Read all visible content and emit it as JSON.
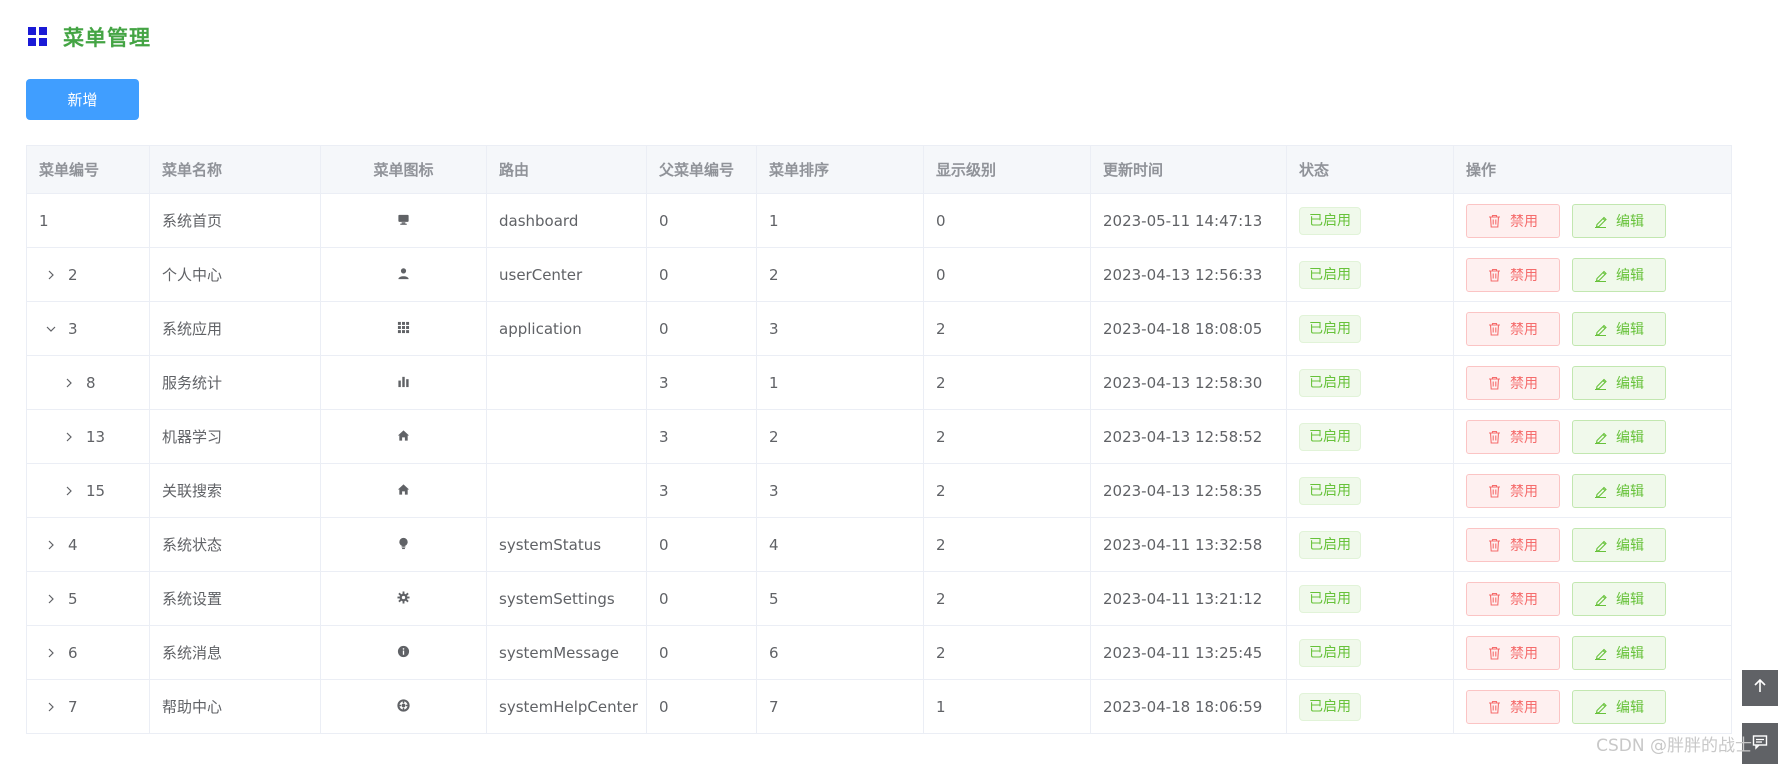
{
  "page": {
    "title": "菜单管理",
    "title_color": "#44a444",
    "icon": "grid-icon"
  },
  "toolbar": {
    "add_label": "新增",
    "add_color": "#409eff"
  },
  "table": {
    "headers": [
      "菜单编号",
      "菜单名称",
      "菜单图标",
      "路由",
      "父菜单编号",
      "菜单排序",
      "显示级别",
      "更新时间",
      "状态",
      "操作"
    ],
    "rows": [
      {
        "id": "1",
        "name": "系统首页",
        "icon": "monitor-icon",
        "route": "dashboard",
        "parent": "0",
        "order": "1",
        "level": "0",
        "updated": "2023-05-11 14:47:13",
        "status": "已启用",
        "indent": 0,
        "expander": "none"
      },
      {
        "id": "2",
        "name": "个人中心",
        "icon": "user-icon",
        "route": "userCenter",
        "parent": "0",
        "order": "2",
        "level": "0",
        "updated": "2023-04-13 12:56:33",
        "status": "已启用",
        "indent": 0,
        "expander": "collapsed"
      },
      {
        "id": "3",
        "name": "系统应用",
        "icon": "apps-icon",
        "route": "application",
        "parent": "0",
        "order": "3",
        "level": "2",
        "updated": "2023-04-18 18:08:05",
        "status": "已启用",
        "indent": 0,
        "expander": "expanded"
      },
      {
        "id": "8",
        "name": "服务统计",
        "icon": "bar-chart-icon",
        "route": "",
        "parent": "3",
        "order": "1",
        "level": "2",
        "updated": "2023-04-13 12:58:30",
        "status": "已启用",
        "indent": 1,
        "expander": "collapsed"
      },
      {
        "id": "13",
        "name": "机器学习",
        "icon": "home-icon",
        "route": "",
        "parent": "3",
        "order": "2",
        "level": "2",
        "updated": "2023-04-13 12:58:52",
        "status": "已启用",
        "indent": 1,
        "expander": "collapsed"
      },
      {
        "id": "15",
        "name": "关联搜索",
        "icon": "home-icon",
        "route": "",
        "parent": "3",
        "order": "3",
        "level": "2",
        "updated": "2023-04-13 12:58:35",
        "status": "已启用",
        "indent": 1,
        "expander": "collapsed"
      },
      {
        "id": "4",
        "name": "系统状态",
        "icon": "bulb-icon",
        "route": "systemStatus",
        "parent": "0",
        "order": "4",
        "level": "2",
        "updated": "2023-04-11 13:32:58",
        "status": "已启用",
        "indent": 0,
        "expander": "collapsed"
      },
      {
        "id": "5",
        "name": "系统设置",
        "icon": "gear-icon",
        "route": "systemSettings",
        "parent": "0",
        "order": "5",
        "level": "2",
        "updated": "2023-04-11 13:21:12",
        "status": "已启用",
        "indent": 0,
        "expander": "collapsed"
      },
      {
        "id": "6",
        "name": "系统消息",
        "icon": "info-icon",
        "route": "systemMessage",
        "parent": "0",
        "order": "6",
        "level": "2",
        "updated": "2023-04-11 13:25:45",
        "status": "已启用",
        "indent": 0,
        "expander": "collapsed"
      },
      {
        "id": "7",
        "name": "帮助中心",
        "icon": "help-icon",
        "route": "systemHelpCenter",
        "parent": "0",
        "order": "7",
        "level": "1",
        "updated": "2023-04-18 18:06:59",
        "status": "已启用",
        "indent": 0,
        "expander": "collapsed"
      }
    ],
    "disable_label": "禁用",
    "edit_label": "编辑",
    "disable_color": "#f56c6c",
    "edit_color": "#67c23a"
  },
  "side": {
    "back_top_icon": "arrow-up-icon",
    "feedback_icon": "chat-icon"
  },
  "watermark": {
    "text": "CSDN @胖胖的战士"
  }
}
